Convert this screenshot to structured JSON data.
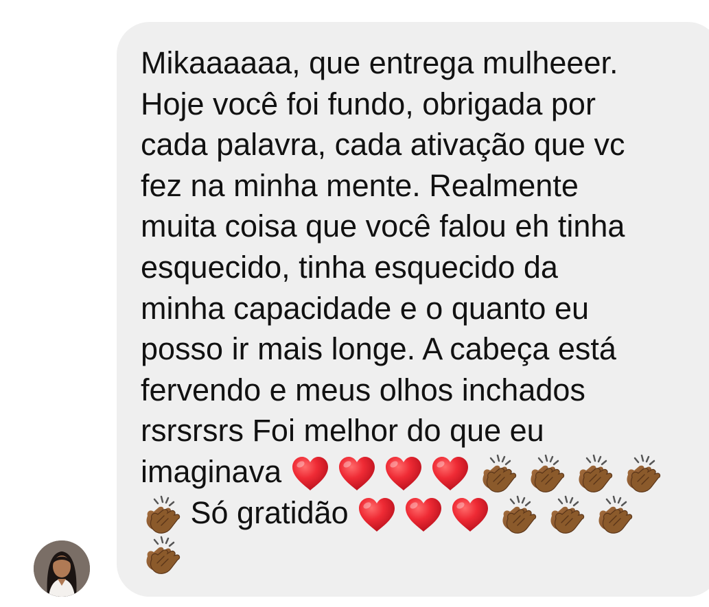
{
  "message": {
    "line_1": "Mikaaaaaa, que entrega mulheeer.",
    "line_2": "Hoje você foi fundo,  obrigada por",
    "line_3": "cada palavra, cada ativação que vc",
    "line_4": "fez na minha mente. Realmente",
    "line_5": "muita coisa que você falou eh tinha",
    "line_6": "esquecido, tinha esquecido da",
    "line_7": "minha capacidade e o quanto eu",
    "line_8": "posso ir mais longe. A cabeça está",
    "line_9": "fervendo e meus olhos inchados",
    "line_10": "rsrsrsrs Foi melhor do que eu",
    "line_11_text": "imaginava",
    "line_12_text": "Só gratidão"
  },
  "icons": {
    "heart": "red-heart-emoji",
    "clap": "clapping-hands-emoji",
    "avatar": "sender-avatar"
  },
  "colors": {
    "bubble": "#efefef",
    "text": "#111111",
    "heart": "#e4202e",
    "clap": "#8b5a2b"
  }
}
